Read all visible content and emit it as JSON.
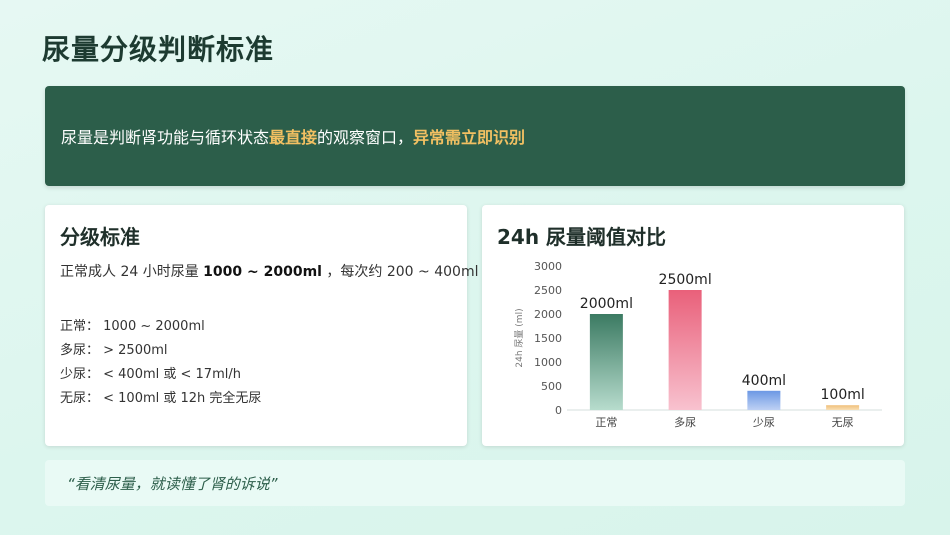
{
  "page": {
    "title": "尿量分级判断标准",
    "banner": {
      "part1": "尿量是判断肾功能与循环状态",
      "highlight1": "最直接",
      "part2": "的观察窗口，",
      "highlight2": "异常需立即识别"
    },
    "left_card": {
      "title": "分级标准",
      "summary_prefix": "正常成人 24 小时尿量 ",
      "summary_bold": "1000 ~ 2000ml",
      "summary_suffix": " ，每次约 200 ~ 400ml",
      "grades": [
        "正常： 1000 ~ 2000ml",
        "多尿： > 2500ml",
        "少尿： < 400ml 或 < 17ml/h",
        "无尿： < 100ml 或 12h 完全无尿"
      ]
    },
    "right_card": {
      "title": "24h 尿量阈值对比"
    },
    "quote": "“看清尿量，就读懂了肾的诉说”"
  },
  "colors": {
    "accent_dark_green": "#2c5e4a",
    "highlight_gold": "#f2c062"
  },
  "chart_data": {
    "type": "bar",
    "title": "24h 尿量阈值对比",
    "ylabel": "24h 尿量 (ml)",
    "ylim": [
      0,
      3000
    ],
    "yticks": [
      0,
      500,
      1000,
      1500,
      2000,
      2500,
      3000
    ],
    "categories": [
      "正常",
      "多尿",
      "少尿",
      "无尿"
    ],
    "values": [
      2000,
      2500,
      400,
      100
    ],
    "data_labels": [
      "2000ml",
      "2500ml",
      "400ml",
      "100ml"
    ],
    "bar_colors": [
      [
        "#3b7a62",
        "#b7dccd"
      ],
      [
        "#e9607a",
        "#f8c2cf"
      ],
      [
        "#6c98e4",
        "#bed1f4"
      ],
      [
        "#f0c07a",
        "#f9dfb4"
      ]
    ],
    "grid": false,
    "legend": "none"
  }
}
